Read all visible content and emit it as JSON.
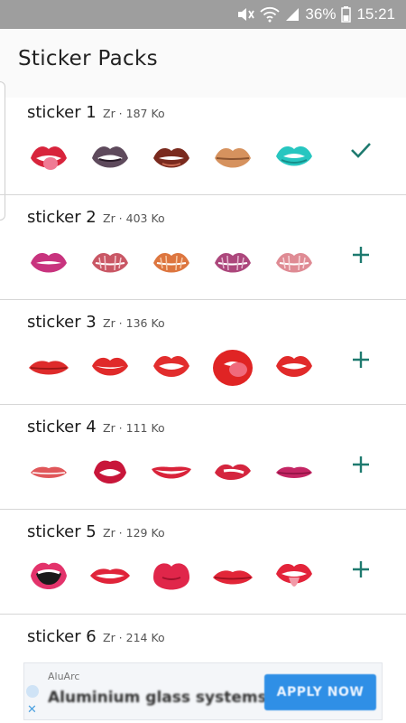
{
  "status": {
    "battery": "36%",
    "time": "15:21"
  },
  "app": {
    "title": "Sticker Packs"
  },
  "packs": [
    {
      "name": "sticker 1",
      "meta": "Zr · 187 Ko",
      "action": "added",
      "stickers": [
        "lips-tongue-out",
        "lips-dark-purple",
        "lips-brown-gloss",
        "lips-nude-smile",
        "lips-teal-bite"
      ]
    },
    {
      "name": "sticker 2",
      "meta": "Zr · 403 Ko",
      "action": "add",
      "stickers": [
        "lips-pink-bite",
        "kiss-print-red",
        "kiss-print-orange",
        "kiss-print-magenta",
        "kiss-print-red-pale"
      ]
    },
    {
      "name": "sticker 3",
      "meta": "Zr · 136 Ko",
      "action": "add",
      "stickers": [
        "lips-red-closed",
        "lips-red-smile",
        "lips-red-open",
        "lips-red-lick",
        "lips-red-teeth"
      ]
    },
    {
      "name": "sticker 4",
      "meta": "Zr · 111 Ko",
      "action": "add",
      "stickers": [
        "lips-coral-closed",
        "lips-crimson-open",
        "lips-red-grin",
        "lips-red-bite",
        "lips-magenta-closed"
      ]
    },
    {
      "name": "sticker 5",
      "meta": "Zr · 129 Ko",
      "action": "add",
      "stickers": [
        "lips-pink-shout",
        "lips-red-teeth-wide",
        "lips-pink-pucker",
        "lips-red-closed-2",
        "lips-red-tongue"
      ]
    },
    {
      "name": "sticker 6",
      "meta": "Zr · 214 Ko",
      "action": "add",
      "stickers": []
    }
  ],
  "ad": {
    "brand": "AluArc",
    "headline": "Aluminium glass systems",
    "button": "APPLY NOW"
  },
  "colors": {
    "accent": "#1e7a6f",
    "status_bar": "#9e9e9e"
  }
}
